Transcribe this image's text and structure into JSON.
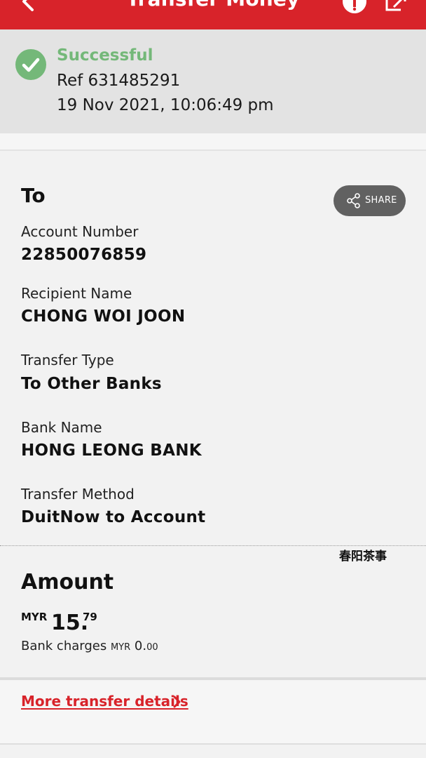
{
  "header": {
    "title": "Transfer Money",
    "bg_color": "#d8232a",
    "icons": [
      "back-arrow-icon",
      "info-icon",
      "exit-icon"
    ]
  },
  "status": {
    "label": "Successful",
    "ref": "Ref 631485291",
    "datetime": "19 Nov 2021, 10:06:49 pm",
    "color": "#74b879",
    "icon": "check-circle-icon"
  },
  "to_section": {
    "title": "To",
    "share_label": "SHARE",
    "fields": [
      {
        "label": "Account Number",
        "value": "22850076859"
      },
      {
        "label": "Recipient Name",
        "value": "CHONG WOI JOON"
      },
      {
        "label": "Transfer Type",
        "value": "To Other Banks"
      },
      {
        "label": "Bank Name",
        "value": "HONG LEONG BANK"
      },
      {
        "label": "Transfer Method",
        "value": "DuitNow to Account"
      }
    ]
  },
  "stamp_text": "春阳茶事",
  "amount_section": {
    "title": "Amount",
    "currency": "MYR",
    "whole": "15.",
    "cents": "79",
    "charges_label": "Bank charges",
    "charges_currency": "MYR",
    "charges_value": "0.",
    "charges_cents": "00"
  },
  "more_details": {
    "label": "More transfer details",
    "color": "#d8232a"
  }
}
